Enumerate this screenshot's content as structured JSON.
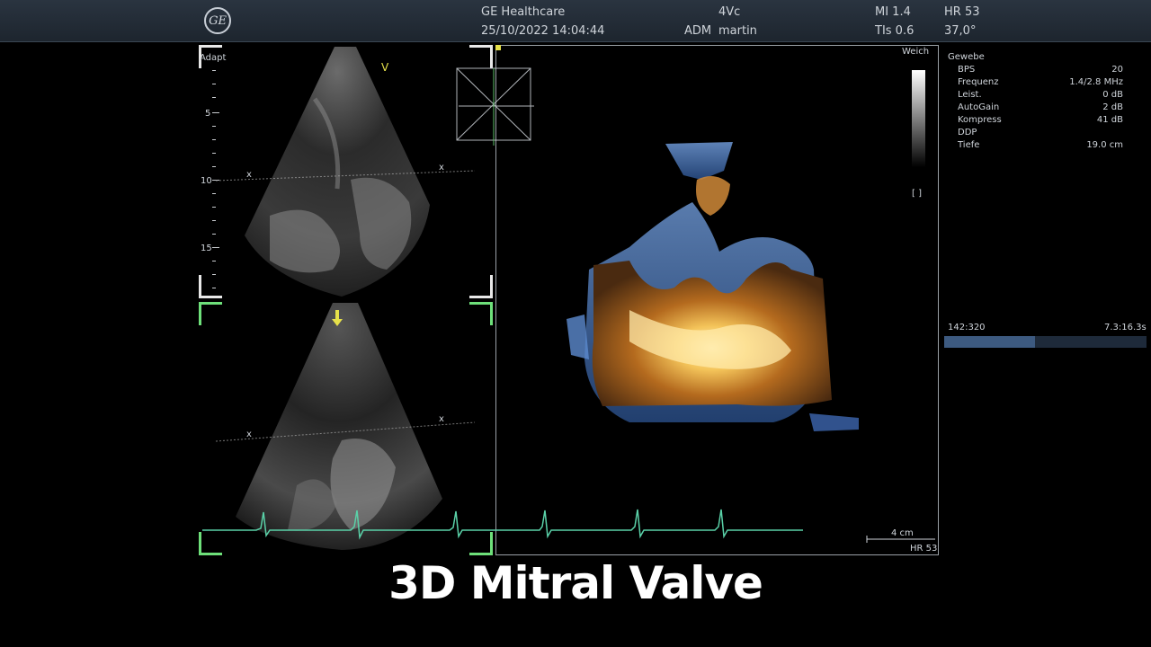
{
  "header": {
    "logo_text": "GE",
    "company": "GE Healthcare",
    "datetime": "25/10/2022 14:04:44",
    "probe": "4Vc",
    "operator_label": "ADM",
    "operator_name": "martin",
    "mi": "MI 1.4",
    "tis": "TIs 0.6",
    "hr": "HR 53",
    "temp": "37,0°"
  },
  "left_panel": {
    "mode_label": "Adapt",
    "depth_marks": [
      "5",
      "10",
      "15"
    ],
    "marker_v": "V",
    "x_mark": "x"
  },
  "render_panel": {
    "map_label": "Weich",
    "scale_label": "4 cm",
    "hr_label": "HR 53"
  },
  "sidebar": {
    "section_title": "Gewebe",
    "params": [
      {
        "key": "BPS",
        "value": "20"
      },
      {
        "key": "Frequenz",
        "value": "1.4/2.8 MHz"
      },
      {
        "key": "Leist.",
        "value": "0 dB"
      },
      {
        "key": "AutoGain",
        "value": "2 dB"
      },
      {
        "key": "Kompress",
        "value": "41 dB"
      },
      {
        "key": "DDP",
        "value": ""
      },
      {
        "key": "Tiefe",
        "value": "19.0 cm"
      }
    ],
    "cine_frames": "142:320",
    "cine_time": "7.3:16.3s",
    "cine_progress": 0.45
  },
  "caption": "3D Mitral Valve",
  "colors": {
    "bracket_white": "#e8e8e8",
    "bracket_green": "#6ee07a",
    "ecg": "#5ad1a8",
    "marker_yellow": "#e6e14a"
  }
}
